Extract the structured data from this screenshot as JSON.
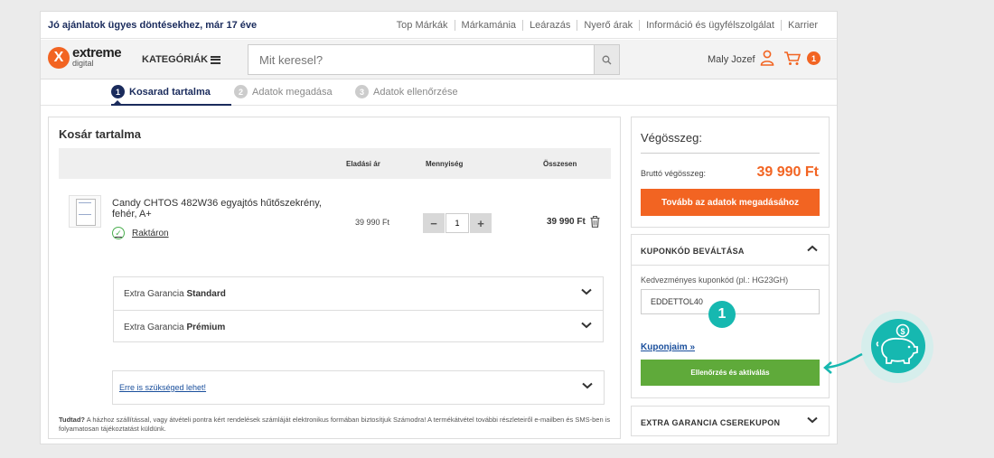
{
  "topbar": {
    "tagline": "Jó ajánlatok ügyes döntésekhez, már 17 éve",
    "links": [
      "Top Márkák",
      "Márkamánia",
      "Leárazás",
      "Nyerő árak",
      "Információ és ügyfélszolgálat",
      "Karrier"
    ]
  },
  "header": {
    "logo_main": "extreme",
    "logo_sub": "digital",
    "logo_mark": "X",
    "categories_label": "KATEGÓRIÁK",
    "search_placeholder": "Mit keresel?",
    "user_name": "Maly Jozef",
    "cart_count": "1"
  },
  "steps": [
    {
      "num": "1",
      "label": "Kosarad tartalma",
      "active": true
    },
    {
      "num": "2",
      "label": "Adatok megadása",
      "active": false
    },
    {
      "num": "3",
      "label": "Adatok ellenőrzése",
      "active": false
    }
  ],
  "cart": {
    "title": "Kosár tartalma",
    "columns": {
      "unit_price": "Eladási ár",
      "quantity": "Mennyiség",
      "total": "Összesen"
    },
    "item": {
      "name": "Candy CHTOS 482W36 egyajtós hűtőszekrény, fehér, A+",
      "stock": "Raktáron",
      "unit_price": "39 990 Ft",
      "quantity": "1",
      "minus": "−",
      "plus": "+",
      "line_total": "39 990 Ft"
    },
    "warranty": [
      {
        "prefix": "Extra Garancia ",
        "name": "Standard"
      },
      {
        "prefix": "Extra Garancia ",
        "name": "Prémium"
      }
    ],
    "maybe_label": "Erre is szükséged lehet!",
    "note_bold": "Tudtad?",
    "note_text": " A házhoz szállítással, vagy átvételi pontra kért rendelések számláját elektronikus formában biztosítjuk Számodra! A termékátvétel további részleteiről e-mailben és SMS-ben is folyamatosan tájékoztatást küldünk."
  },
  "summary": {
    "title": "Végösszeg:",
    "gross_label": "Bruttó végösszeg:",
    "gross_value": "39 990 Ft",
    "cta_label": "Tovább az adatok megadásához"
  },
  "coupon": {
    "heading": "KUPONKÓD BEVÁLTÁSA",
    "label": "Kedvezményes kuponkód (pl.: HG23GH)",
    "value": "EDDETTOL40",
    "marker": "1",
    "my_coupons": "Kuponjaim »",
    "activate_label": "Ellenőrzés és aktiválás"
  },
  "extra_coupon": {
    "heading": "EXTRA GARANCIA CSEREKUPON"
  },
  "colors": {
    "brand_orange": "#f26422",
    "navy": "#1a2b5c",
    "green": "#5faa3a",
    "teal": "#16b8b0"
  }
}
